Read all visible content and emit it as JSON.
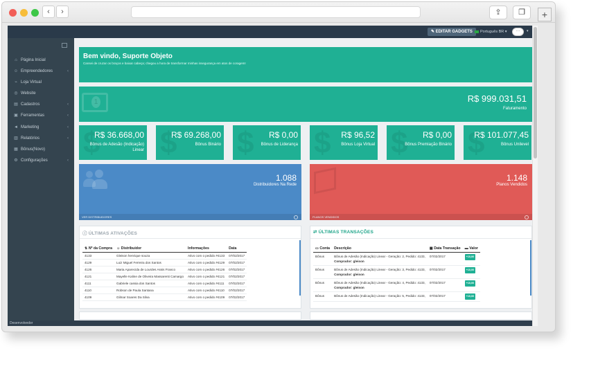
{
  "topbar": {
    "edit_gadgets": "EDITAR GADGETS",
    "language": "Português BR",
    "avatar": "···"
  },
  "sidebar": {
    "items": [
      {
        "label": "Página Inicial",
        "icon": "home-icon",
        "chevron": false
      },
      {
        "label": "Empreendedores",
        "icon": "user-icon",
        "chevron": true
      },
      {
        "label": "Loja Virtual",
        "icon": "cart-icon",
        "chevron": false
      },
      {
        "label": "Website",
        "icon": "globe-icon",
        "chevron": false
      },
      {
        "label": "Cadastros",
        "icon": "file-icon",
        "chevron": true
      },
      {
        "label": "Ferramentas",
        "icon": "briefcase-icon",
        "chevron": true
      },
      {
        "label": "Marketing",
        "icon": "megaphone-icon",
        "chevron": true
      },
      {
        "label": "Relatórios",
        "icon": "database-icon",
        "chevron": true
      },
      {
        "label": "Bônus(Novo)",
        "icon": "grid-icon",
        "chevron": false
      },
      {
        "label": "Configurações",
        "icon": "gear-icon",
        "chevron": true
      }
    ]
  },
  "welcome": {
    "title": "Bem vindo, Suporte Objeto",
    "subtitle": "Cansei de cruzar os braços e baixar cabeça; chegou a hora de transformar minhas insegurança em atos de coragem!"
  },
  "faturamento": {
    "value": "R$ 999.031,51",
    "label": "Faturamento"
  },
  "bonus_tiles": [
    {
      "value": "R$ 36.668,00",
      "label": "Bônus de Adesão (Indicação) Linear"
    },
    {
      "value": "R$ 69.268,00",
      "label": "Bônus Binário"
    },
    {
      "value": "R$ 0,00",
      "label": "Bônus de Liderança"
    },
    {
      "value": "R$ 96,52",
      "label": "Bônus Loja Virtual"
    },
    {
      "value": "R$ 0,00",
      "label": "Bônus Premiação Binário"
    },
    {
      "value": "R$ 101.077,45",
      "label": "Bônus Unilevel"
    }
  ],
  "distribuidores": {
    "value": "1.088",
    "label": "Distribuidores Na Rede",
    "link": "VER DISTRIBUIDORES"
  },
  "planos": {
    "value": "1.148",
    "label": "Planos Vendidos",
    "link": "PLANOS VENDIDOS"
  },
  "ativacoes": {
    "title": "ÚLTIMAS ATIVAÇÕES",
    "headers": [
      "Nº da Compra",
      "Distribuidor",
      "Informações",
      "Data"
    ],
    "rows": [
      [
        "4133",
        "Gleison henrique souza",
        "Ativo com o pedido #4133",
        "07/02/2017"
      ],
      [
        "4129",
        "Luiz Miguel Ferreira dos Santos",
        "Ativo com o pedido #4129",
        "07/02/2017"
      ],
      [
        "4126",
        "Maria Aparecida de Lourdes Assis Franco",
        "Ativo com o pedido #4126",
        "07/02/2017"
      ],
      [
        "4121",
        "Mayelle Kaline de Oliveira Massarenti Camargo",
        "Ativo com o pedido #4121",
        "07/02/2017"
      ],
      [
        "4111",
        "Gabriele cassia dos Santos",
        "Ativo com o pedido #4111",
        "07/02/2017"
      ],
      [
        "4110",
        "Robson de Paula Santana",
        "Ativo com o pedido #4110",
        "07/02/2017"
      ],
      [
        "4109",
        "Gilmar Soares Da Silva",
        "Ativo com o pedido #4109",
        "07/02/2017"
      ]
    ]
  },
  "transacoes": {
    "title": "ÚLTIMAS TRANSAÇÕES",
    "headers": [
      "Conta",
      "Descrição",
      "Data Transação",
      "Valor"
    ],
    "rows": [
      {
        "conta": "Bônus",
        "desc": "Bônus de Adesão (Indicação) Linear - Geração: 2, Pedido: 4133,",
        "comprador": "Comprador: gleison",
        "data": "07/02/2017",
        "valor": "+10,00"
      },
      {
        "conta": "Bônus",
        "desc": "Bônus de Adesão (Indicação) Linear - Geração: 3, Pedido: 4133,",
        "comprador": "Comprador: gleison",
        "data": "07/02/2017",
        "valor": "+10,00"
      },
      {
        "conta": "Bônus",
        "desc": "Bônus de Adesão (Indicação) Linear - Geração: 4, Pedido: 4133,",
        "comprador": "Comprador: gleison",
        "data": "07/02/2017",
        "valor": "+10,00"
      },
      {
        "conta": "Bônus",
        "desc": "Bônus de Adesão (Indicação) Linear - Geração: 5, Pedido: 4133,",
        "comprador": "",
        "data": "07/02/2017",
        "valor": "+10,00"
      }
    ]
  },
  "footer": {
    "text": "Desenvolvedor"
  },
  "colors": {
    "teal": "#1fb094",
    "blue": "#4b8ac7",
    "red": "#e05a57",
    "sidebar": "#34444f"
  }
}
